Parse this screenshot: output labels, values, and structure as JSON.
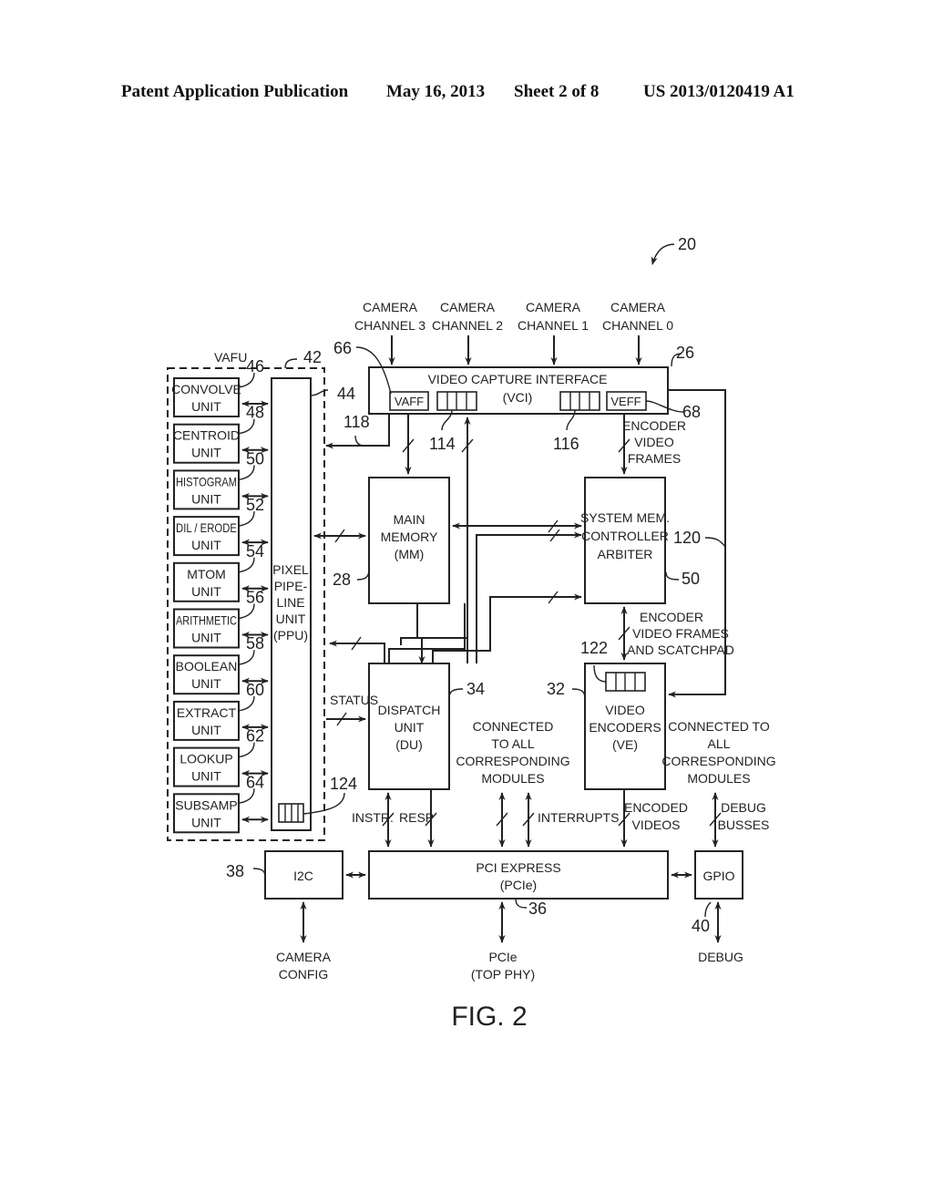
{
  "header": {
    "publication": "Patent Application Publication",
    "date": "May 16, 2013",
    "sheet": "Sheet 2 of 8",
    "number": "US 2013/0120419 A1"
  },
  "figure": {
    "caption": "FIG. 2",
    "system_ref": "20",
    "camera_channels": [
      {
        "line1": "CAMERA",
        "line2": "CHANNEL 3"
      },
      {
        "line1": "CAMERA",
        "line2": "CHANNEL 2"
      },
      {
        "line1": "CAMERA",
        "line2": "CHANNEL 1"
      },
      {
        "line1": "CAMERA",
        "line2": "CHANNEL 0"
      }
    ],
    "vafu": {
      "label": "VAFU",
      "ref": "42",
      "units": [
        {
          "line1": "CONVOLVE",
          "line2": "UNIT",
          "ref": "46"
        },
        {
          "line1": "CENTROID",
          "line2": "UNIT",
          "ref": "48"
        },
        {
          "line1": "HISTOGRAM",
          "line2": "UNIT",
          "ref": "50"
        },
        {
          "line1": "DIL / ERODE",
          "line2": "UNIT",
          "ref": "52"
        },
        {
          "line1": "MTOM",
          "line2": "UNIT",
          "ref": "54"
        },
        {
          "line1": "ARITHMETIC",
          "line2": "UNIT",
          "ref": "56"
        },
        {
          "line1": "BOOLEAN",
          "line2": "UNIT",
          "ref": "58"
        },
        {
          "line1": "EXTRACT",
          "line2": "UNIT",
          "ref": "60"
        },
        {
          "line1": "LOOKUP",
          "line2": "UNIT",
          "ref": "62"
        },
        {
          "line1": "SUBSAMP",
          "line2": "UNIT",
          "ref": "64"
        }
      ],
      "ppu": {
        "lines": [
          "PIXEL",
          "PIPE-",
          "LINE",
          "UNIT",
          "(PPU)"
        ],
        "ref": "44",
        "buffer_ref": "124"
      }
    },
    "vci": {
      "line1": "VIDEO  CAPTURE  INTERFACE",
      "line2": "(VCI)",
      "ref": "26",
      "vaff": "VAFF",
      "vaff_ref": "66",
      "veff": "VEFF",
      "veff_ref": "68",
      "buffer_left_ref": "114",
      "buffer_right_ref": "116",
      "link_ref": "118"
    },
    "main_memory": {
      "lines": [
        "MAIN",
        "MEMORY",
        "(MM)"
      ],
      "ref": "28"
    },
    "smc": {
      "lines": [
        "SYSTEM  MEM.",
        "CONTROLLER",
        "ARBITER"
      ],
      "ref": "50"
    },
    "encoder_video_frames": [
      "ENCODER",
      "VIDEO",
      "FRAMES"
    ],
    "encoder_scratchpad": [
      "ENCODER",
      "VIDEO FRAMES",
      "AND SCATCHPAD"
    ],
    "feedback_ref": "120",
    "dispatch": {
      "lines": [
        "DISPATCH",
        "UNIT",
        "(DU)"
      ],
      "ref": "34"
    },
    "video_encoders": {
      "lines": [
        "VIDEO",
        "ENCODERS",
        "(VE)"
      ],
      "ref": "32",
      "buffer_ref": "122"
    },
    "status_label": "STATUS",
    "connected_center": [
      "CONNECTED",
      "TO  ALL",
      "CORRESPONDING",
      "MODULES"
    ],
    "connected_right": [
      "CONNECTED  TO",
      "ALL",
      "CORRESPONDING",
      "MODULES"
    ],
    "instr_label": "INSTR.",
    "resp_label": "RESP",
    "interrupts_label": "INTERRUPTS",
    "encoded_videos": [
      "ENCODED",
      "VIDEOS"
    ],
    "debug_busses": [
      "DEBUG",
      "BUSSES"
    ],
    "pcie": {
      "line1": "PCI EXPRESS",
      "line2": "(PCIe)",
      "ref": "36"
    },
    "i2c": {
      "label": "I2C",
      "ref": "38"
    },
    "gpio": {
      "label": "GPIO",
      "ref": "40"
    },
    "camera_config": [
      "CAMERA",
      "CONFIG"
    ],
    "pcie_phy": [
      "PCIe",
      "(TOP  PHY)"
    ],
    "debug": "DEBUG"
  }
}
